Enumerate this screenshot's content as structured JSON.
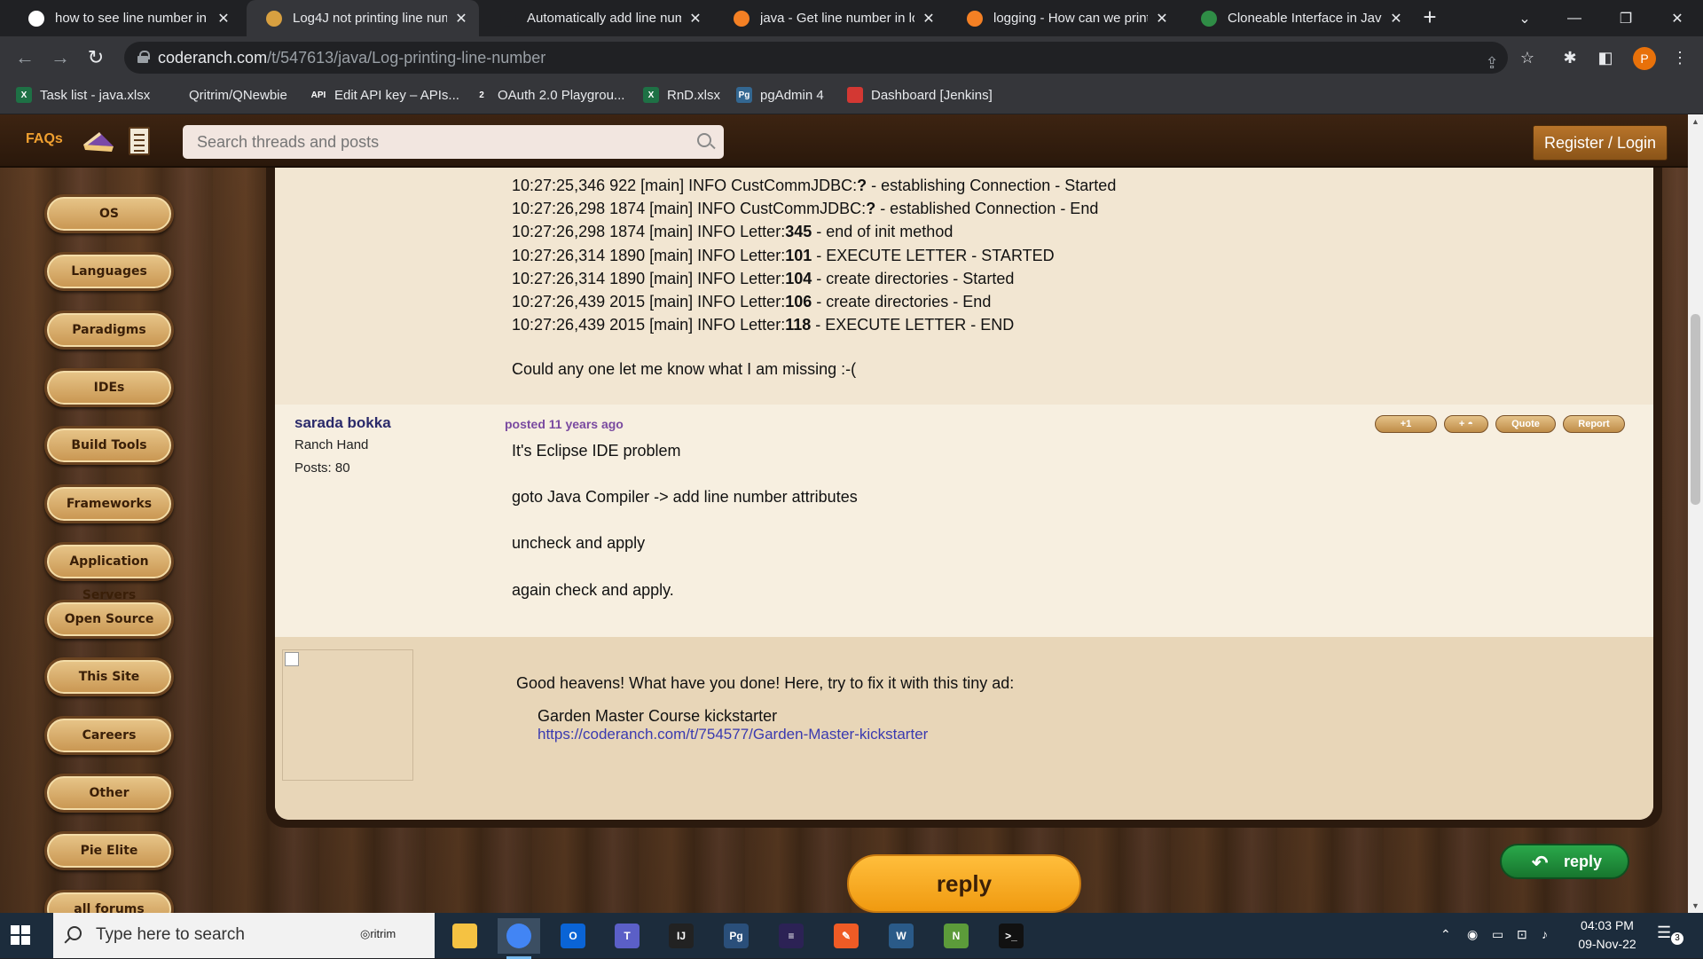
{
  "browser": {
    "tabs": [
      {
        "title": "how to see line number in l",
        "active": false,
        "favicon_color": "#ffffff"
      },
      {
        "title": "Log4J not printing line num",
        "active": true,
        "favicon_color": "#d8a040"
      },
      {
        "title": "Automatically add line num",
        "active": false,
        "favicon_color": "#202124"
      },
      {
        "title": "java - Get line number in lo",
        "active": false,
        "favicon_color": "#f48024"
      },
      {
        "title": "logging - How can we print",
        "active": false,
        "favicon_color": "#f48024"
      },
      {
        "title": "Cloneable Interface in Java",
        "active": false,
        "favicon_color": "#2f8d46"
      }
    ],
    "url_host": "coderanch.com",
    "url_path": "/t/547613/java/Log-printing-line-number",
    "profile_letter": "P",
    "bookmarks": [
      {
        "label": "Task list - java.xlsx",
        "icon": "excel-icon",
        "icon_text": "X",
        "color": "#1e7145"
      },
      {
        "label": "Qritrim/QNewbie",
        "icon": "github-icon",
        "icon_text": "",
        "color": "#35363a"
      },
      {
        "label": "Edit API key – APIs...",
        "icon": "api-icon",
        "icon_text": "API",
        "color": "#35363a"
      },
      {
        "label": "OAuth 2.0 Playgrou...",
        "icon": "oauth-icon",
        "icon_text": "2",
        "color": "#35363a"
      },
      {
        "label": "RnD.xlsx",
        "icon": "excel-icon",
        "icon_text": "X",
        "color": "#1e7145"
      },
      {
        "label": "pgAdmin 4",
        "icon": "pgadmin-icon",
        "icon_text": "Pg",
        "color": "#336791"
      },
      {
        "label": "Dashboard [Jenkins]",
        "icon": "jenkins-icon",
        "icon_text": "",
        "color": "#d33833"
      }
    ]
  },
  "site": {
    "faqs_label": "FAQs",
    "search_placeholder": "Search threads and posts",
    "login_label": "Register / Login",
    "sidebar": [
      "OS",
      "Languages",
      "Paradigms",
      "IDEs",
      "Build Tools",
      "Frameworks",
      "Application Servers",
      "Open Source",
      "This Site",
      "Careers",
      "Other",
      "Pie Elite",
      "all forums"
    ]
  },
  "post1": {
    "log_lines": [
      {
        "prefix": "10:27:25,346 922 [main] INFO CustCommJDBC:",
        "num": "?",
        "suffix": " - establishing Connection - Started"
      },
      {
        "prefix": "10:27:26,298 1874 [main] INFO CustCommJDBC:",
        "num": "?",
        "suffix": " - established Connection - End"
      },
      {
        "prefix": "10:27:26,298 1874 [main] INFO Letter:",
        "num": "345",
        "suffix": " - end of init method"
      },
      {
        "prefix": "10:27:26,314 1890 [main] INFO Letter:",
        "num": "101",
        "suffix": " - EXECUTE LETTER - STARTED"
      },
      {
        "prefix": "10:27:26,314 1890 [main] INFO Letter:",
        "num": "104",
        "suffix": " - create directories - Started"
      },
      {
        "prefix": "10:27:26,439 2015 [main] INFO Letter:",
        "num": "106",
        "suffix": " - create directories - End"
      },
      {
        "prefix": "10:27:26,439 2015 [main] INFO Letter:",
        "num": "118",
        "suffix": " - EXECUTE LETTER - END"
      }
    ],
    "closing": "Could any one let me know what I am missing :-("
  },
  "post2": {
    "author": "sarada bokka",
    "rank": "Ranch Hand",
    "posts": "Posts: 80",
    "posted": "posted 11 years ago",
    "buttons": [
      "+1",
      "+",
      "Quote",
      "Report"
    ],
    "lines": [
      "It's Eclipse IDE problem",
      "goto Java Compiler -> add line number attributes",
      "uncheck and apply",
      "again check and apply."
    ]
  },
  "ad": {
    "intro": "Good heavens! What have you done! Here, try to fix it with this tiny ad:",
    "title": "Garden Master Course kickstarter",
    "link": "https://coderanch.com/t/754577/Garden-Master-kickstarter"
  },
  "reply_big_label": "reply",
  "reply_small_label": "reply",
  "taskbar": {
    "search_placeholder": "Type here to search",
    "qritrim_label": "ritrim",
    "time": "04:03 PM",
    "date": "09-Nov-22",
    "notification_count": "3",
    "apps": [
      {
        "name": "file-explorer-icon",
        "color": "#f5c242",
        "text": ""
      },
      {
        "name": "chrome-icon",
        "color": "#4285f4",
        "text": ""
      },
      {
        "name": "outlook-icon",
        "color": "#0a64d6",
        "text": "O"
      },
      {
        "name": "teams-icon",
        "color": "#5b5fc7",
        "text": "T"
      },
      {
        "name": "intellij-icon",
        "color": "#222222",
        "text": "IJ"
      },
      {
        "name": "pgadmin-icon",
        "color": "#2a4f7a",
        "text": "Pg"
      },
      {
        "name": "eclipse-icon",
        "color": "#2c2255",
        "text": "≡"
      },
      {
        "name": "postman-icon",
        "color": "#ef5b25",
        "text": "✎"
      },
      {
        "name": "mysql-workbench-icon",
        "color": "#2a5a88",
        "text": "W"
      },
      {
        "name": "notepad-icon",
        "color": "#5c9b3a",
        "text": "N"
      },
      {
        "name": "terminal-icon",
        "color": "#111111",
        "text": ">_"
      }
    ]
  }
}
